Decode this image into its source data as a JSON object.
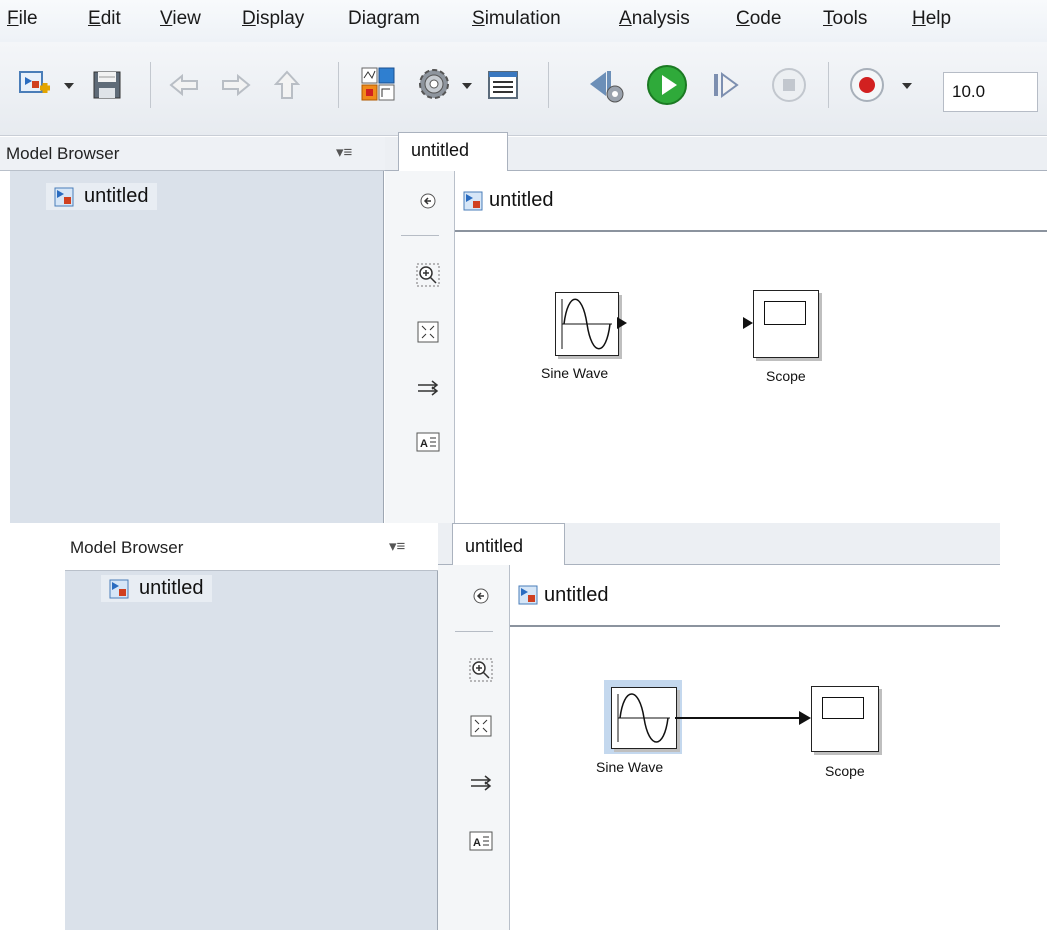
{
  "menu": {
    "items": [
      {
        "pre": "",
        "u": "F",
        "post": "ile"
      },
      {
        "pre": "",
        "u": "E",
        "post": "dit"
      },
      {
        "pre": "",
        "u": "V",
        "post": "iew"
      },
      {
        "pre": "",
        "u": "D",
        "post": "isplay"
      },
      {
        "pre": "Dia",
        "u": "g",
        "post": "ram"
      },
      {
        "pre": "",
        "u": "S",
        "post": "imulation"
      },
      {
        "pre": "",
        "u": "A",
        "post": "nalysis"
      },
      {
        "pre": "",
        "u": "C",
        "post": "ode"
      },
      {
        "pre": "",
        "u": "T",
        "post": "ools"
      },
      {
        "pre": "",
        "u": "H",
        "post": "elp"
      }
    ]
  },
  "toolbar": {
    "stop_time": "10.0",
    "icons": [
      "new-model-icon",
      "save-icon",
      "back-arrow-icon",
      "forward-arrow-icon",
      "up-arrow-icon",
      "library-browser-icon",
      "model-config-gear-icon",
      "model-explorer-icon",
      "step-back-icon",
      "run-icon",
      "step-forward-icon",
      "stop-icon",
      "record-icon"
    ]
  },
  "panel_top": {
    "model_browser_label": "Model Browser",
    "tree_item": "untitled",
    "tab_label": "untitled",
    "canvas_title": "untitled",
    "blocks": {
      "sine_label": "Sine Wave",
      "scope_label": "Scope"
    },
    "connected": false
  },
  "panel_bottom": {
    "model_browser_label": "Model Browser",
    "tree_item": "untitled",
    "tab_label": "untitled",
    "canvas_title": "untitled",
    "blocks": {
      "sine_label": "Sine Wave",
      "scope_label": "Scope"
    },
    "connected": true
  },
  "colors": {
    "run_green": "#2faa3a",
    "record_red": "#d22020",
    "tree_bg": "#dae1ea",
    "selected_block": "#c4d8ee"
  }
}
